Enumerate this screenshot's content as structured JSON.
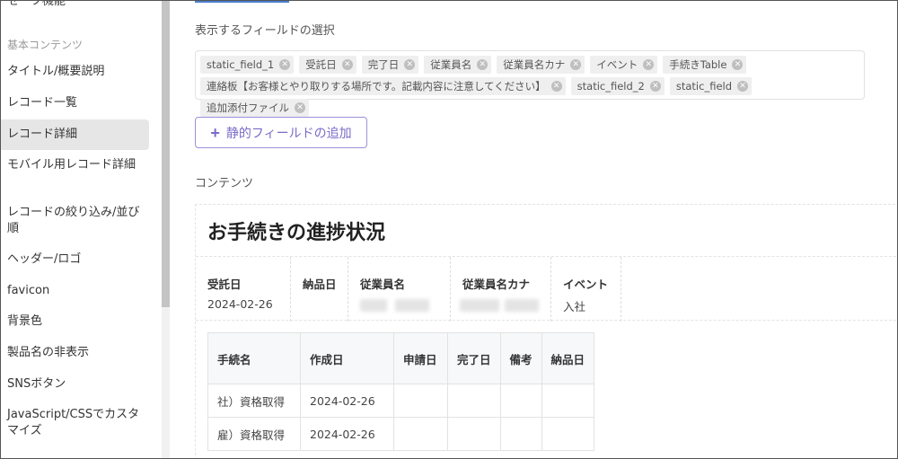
{
  "sidebar": {
    "top_cut_label": "セ一フ機能",
    "section_label": "基本コンテンツ",
    "items": [
      {
        "label": "タイトル/概要説明"
      },
      {
        "label": "レコード一覧"
      },
      {
        "label": "レコード詳細"
      },
      {
        "label": "モバイル用レコード詳細"
      },
      {
        "label": "レコードの絞り込み/並び順"
      },
      {
        "label": "ヘッダー/ロゴ"
      },
      {
        "label": "favicon"
      },
      {
        "label": "背景色"
      },
      {
        "label": "製品名の非表示"
      },
      {
        "label": "SNSボタン"
      },
      {
        "label": "JavaScript/CSSでカスタマイズ"
      }
    ]
  },
  "field_select": {
    "label": "表示するフィールドの選択",
    "chips": [
      {
        "label": "static_field_1"
      },
      {
        "label": "受託日"
      },
      {
        "label": "完了日"
      },
      {
        "label": "従業員名"
      },
      {
        "label": "従業員名カナ"
      },
      {
        "label": "イベント"
      },
      {
        "label": "手続きTable"
      },
      {
        "label": "連絡板【お客様とやり取りする場所です。記載内容に注意してください】"
      },
      {
        "label": "static_field_2"
      },
      {
        "label": "static_field"
      },
      {
        "label": "追加添付ファイル"
      }
    ]
  },
  "add_button": {
    "icon": "plus-icon",
    "label": "静的フィールドの追加"
  },
  "content_section": {
    "label": "コンテンツ"
  },
  "preview": {
    "title": "お手続きの進捗状況",
    "fields": {
      "received_date": {
        "label": "受託日",
        "value": "2024-02-26"
      },
      "delivery_date": {
        "label": "納品日",
        "value": ""
      },
      "employee_name": {
        "label": "従業員名"
      },
      "employee_kana": {
        "label": "従業員名カナ"
      },
      "event": {
        "label": "イベント",
        "value": "入社"
      }
    },
    "table": {
      "headers": [
        "手続名",
        "作成日",
        "申請日",
        "完了日",
        "備考",
        "納品日"
      ],
      "rows": [
        [
          "社）資格取得",
          "2024-02-26",
          "",
          "",
          "",
          ""
        ],
        [
          "雇）資格取得",
          "2024-02-26",
          "",
          "",
          "",
          ""
        ]
      ]
    }
  },
  "colors": {
    "accent": "#7b6bc8",
    "top_accent": "#4a7fcf"
  }
}
